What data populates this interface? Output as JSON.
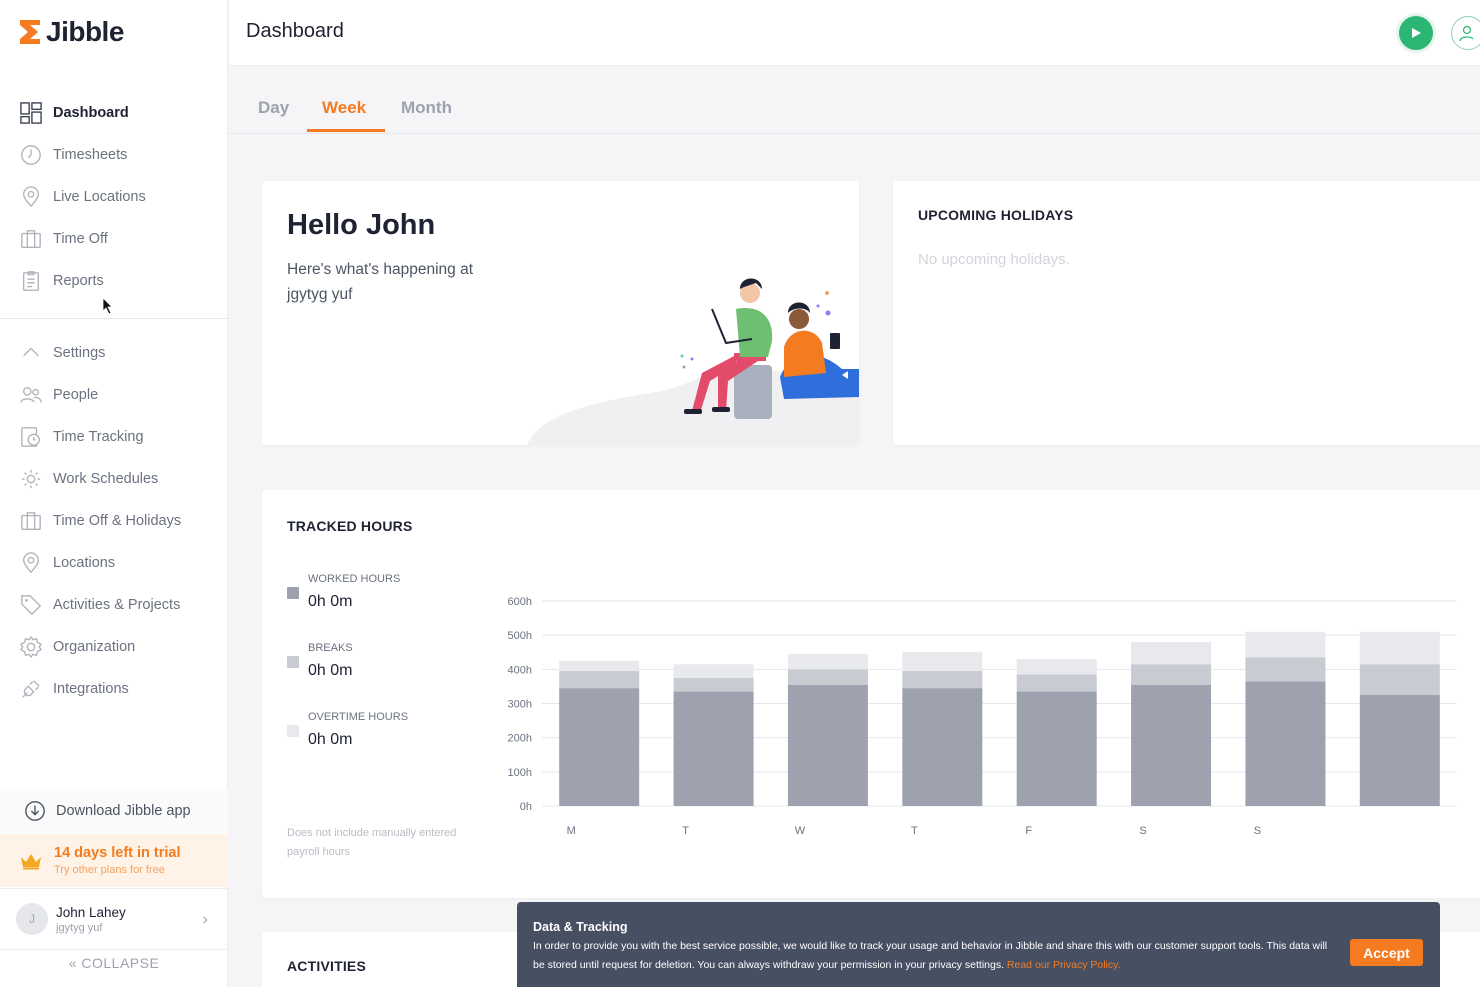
{
  "app": {
    "name": "Jibble",
    "brand_color": "#f47b20"
  },
  "sidebar": {
    "primary": [
      {
        "label": "Dashboard",
        "icon": "dashboard-icon",
        "active": true
      },
      {
        "label": "Timesheets",
        "icon": "clock-icon"
      },
      {
        "label": "Live Locations",
        "icon": "map-pin-icon"
      },
      {
        "label": "Time Off",
        "icon": "briefcase-icon"
      },
      {
        "label": "Reports",
        "icon": "report-icon"
      }
    ],
    "secondary": [
      {
        "label": "Settings",
        "icon": "chevron-up-icon"
      },
      {
        "label": "People",
        "icon": "people-icon"
      },
      {
        "label": "Time Tracking",
        "icon": "time-tracking-icon"
      },
      {
        "label": "Work Schedules",
        "icon": "schedule-icon"
      },
      {
        "label": "Time Off & Holidays",
        "icon": "briefcase-icon"
      },
      {
        "label": "Locations",
        "icon": "map-pin-icon"
      },
      {
        "label": "Activities & Projects",
        "icon": "tag-icon"
      },
      {
        "label": "Organization",
        "icon": "gear-icon"
      },
      {
        "label": "Integrations",
        "icon": "plug-icon"
      }
    ],
    "download_label": "Download Jibble app",
    "trial": {
      "title": "14 days left in trial",
      "subtitle": "Try other plans for free"
    },
    "user": {
      "initial": "J",
      "name": "John Lahey",
      "org": "jgytyg yuf"
    },
    "collapse_label": "COLLAPSE"
  },
  "header": {
    "title": "Dashboard"
  },
  "tabs": [
    {
      "label": "Day"
    },
    {
      "label": "Week",
      "active": true
    },
    {
      "label": "Month"
    }
  ],
  "hello": {
    "title": "Hello John",
    "subtitle": "Here's what's happening at jgytyg yuf"
  },
  "holidays": {
    "heading": "UPCOMING HOLIDAYS",
    "empty_text": "No upcoming holidays."
  },
  "tracked": {
    "heading": "TRACKED HOURS",
    "legend": [
      {
        "label": "WORKED HOURS",
        "value": "0h 0m",
        "color": "#9ea2af"
      },
      {
        "label": "BREAKS",
        "value": "0h 0m",
        "color": "#c9cbd2"
      },
      {
        "label": "OVERTIME HOURS",
        "value": "0h 0m",
        "color": "#e8e9ec"
      }
    ],
    "note": "Does not include manually entered payroll hours"
  },
  "chart_data": {
    "type": "bar",
    "stacked": true,
    "categories": [
      "M",
      "T",
      "W",
      "T",
      "F",
      "S",
      "S",
      ""
    ],
    "y_ticks": [
      "0h",
      "100h",
      "200h",
      "300h",
      "400h",
      "500h",
      "600h"
    ],
    "ylim": [
      0,
      600
    ],
    "grid": true,
    "series": [
      {
        "name": "WORKED HOURS",
        "color": "#9ea2af",
        "values": [
          345,
          335,
          355,
          345,
          335,
          355,
          365,
          325
        ]
      },
      {
        "name": "BREAKS",
        "color": "#c9cbd2",
        "values": [
          50,
          40,
          45,
          50,
          50,
          60,
          70,
          90
        ]
      },
      {
        "name": "OVERTIME HOURS",
        "color": "#e8e9ec",
        "values": [
          30,
          40,
          45,
          55,
          45,
          65,
          75,
          95
        ]
      }
    ]
  },
  "activities": {
    "heading": "ACTIVITIES"
  },
  "cookie_banner": {
    "title": "Data & Tracking",
    "text": "In order to provide you with the best service possible, we would like to track your usage and behavior in Jibble and share this with our customer support tools. This data will be stored until request for deletion. You can always withdraw your permission in your privacy settings.",
    "link": "Read our Privacy Policy.",
    "accept_label": "Accept"
  }
}
